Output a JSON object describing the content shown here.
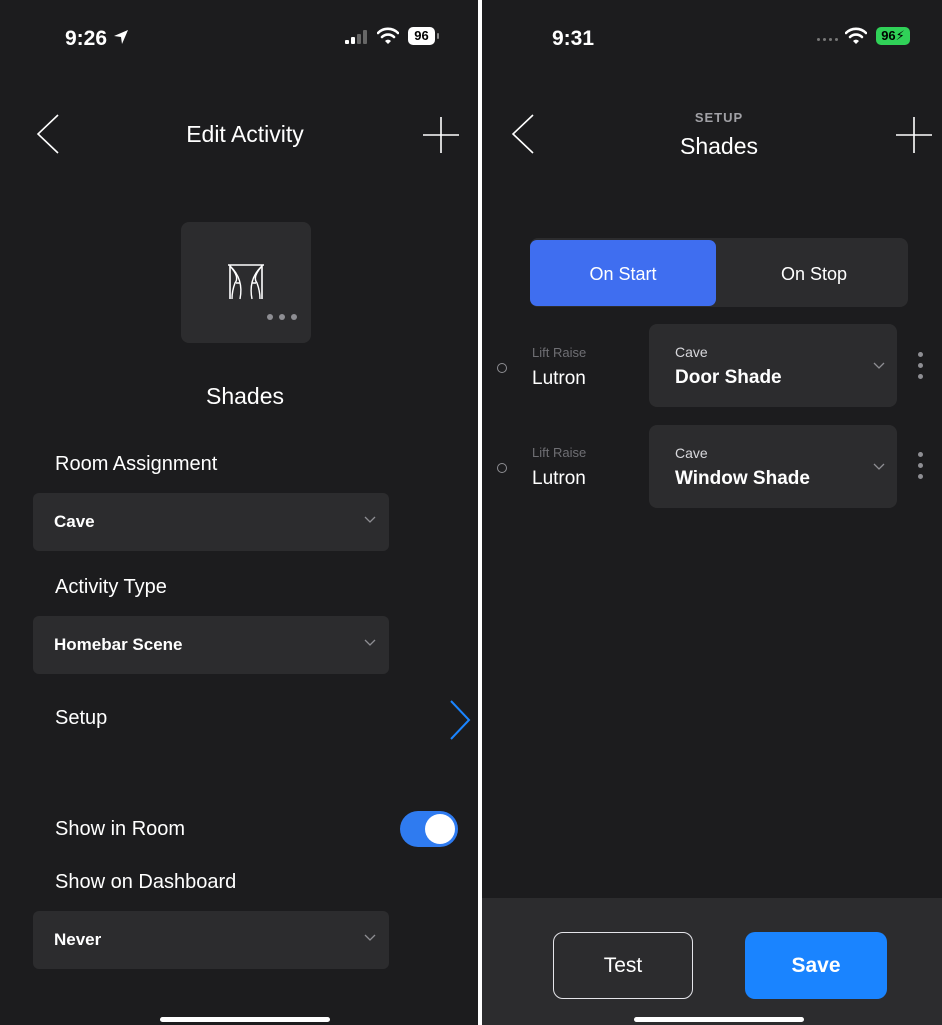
{
  "left": {
    "status": {
      "time": "9:26",
      "battery": "96"
    },
    "nav": {
      "title": "Edit Activity"
    },
    "activity_name": "Shades",
    "room_assignment": {
      "label": "Room Assignment",
      "value": "Cave"
    },
    "activity_type": {
      "label": "Activity Type",
      "value": "Homebar Scene"
    },
    "setup": {
      "label": "Setup"
    },
    "show_in_room": {
      "label": "Show in Room",
      "enabled": true
    },
    "show_on_dashboard": {
      "label": "Show on Dashboard",
      "value": "Never"
    }
  },
  "right": {
    "status": {
      "time": "9:31",
      "battery": "96"
    },
    "nav": {
      "subtitle": "SETUP",
      "title": "Shades"
    },
    "segments": {
      "on_start": "On Start",
      "on_stop": "On Stop",
      "selected": "on_start"
    },
    "rows": [
      {
        "action": "Lift Raise",
        "brand": "Lutron",
        "room": "Cave",
        "device": "Door Shade"
      },
      {
        "action": "Lift Raise",
        "brand": "Lutron",
        "room": "Cave",
        "device": "Window Shade"
      }
    ],
    "buttons": {
      "test": "Test",
      "save": "Save"
    }
  },
  "colors": {
    "background": "#1c1c1e",
    "card": "#2c2c2e",
    "accent": "#1a84ff",
    "segment_active": "#3f6ef0",
    "toggle_on": "#2f7bf0",
    "battery_charging": "#30d158"
  },
  "icons": [
    "back-chevron-icon",
    "plus-icon",
    "curtains-icon",
    "more-dots-icon",
    "chevron-down-icon",
    "chevron-right-icon",
    "location-arrow-icon",
    "signal-icon",
    "wifi-icon",
    "battery-icon",
    "bolt-icon",
    "kebab-icon"
  ]
}
